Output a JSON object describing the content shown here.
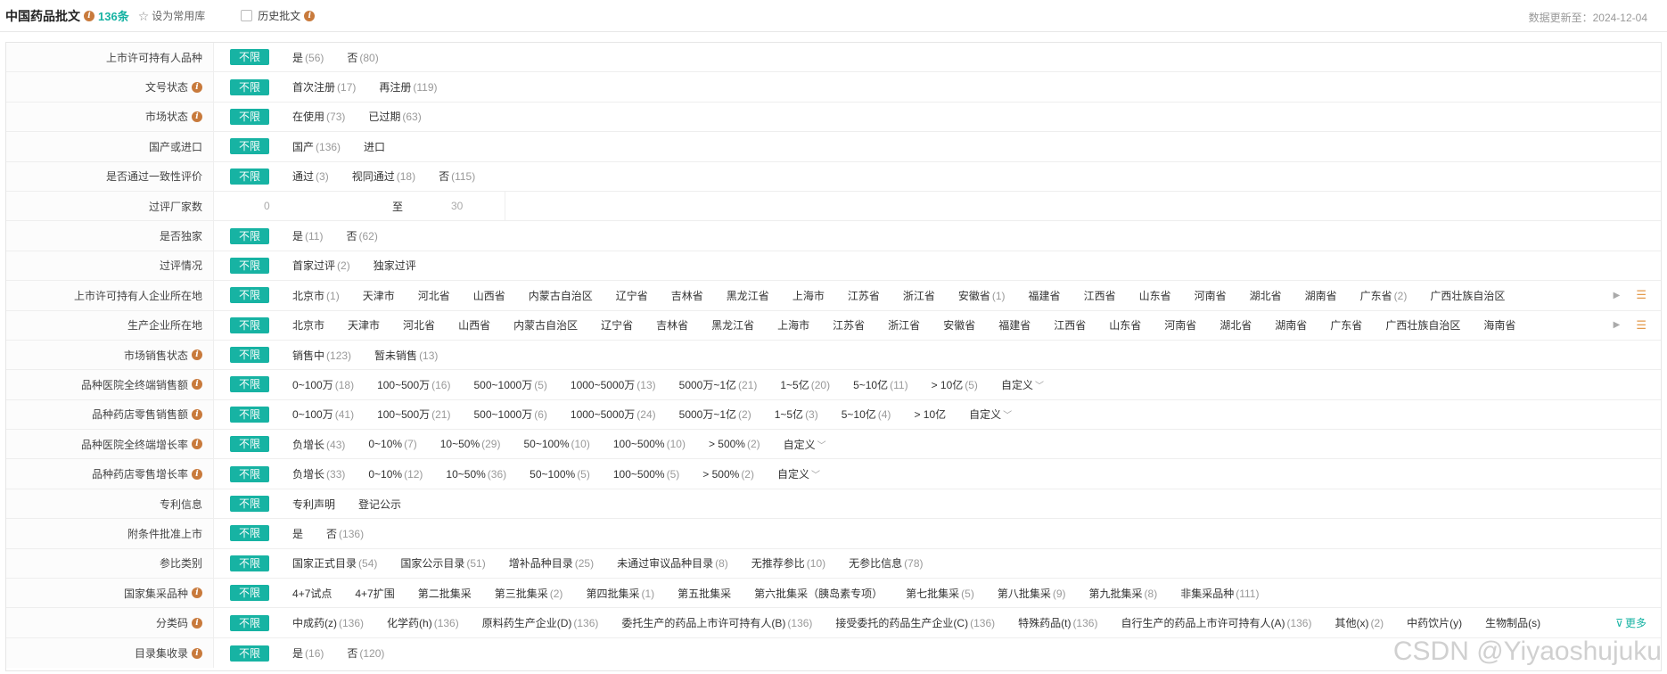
{
  "header": {
    "title": "中国药品批文",
    "count": "136条",
    "favorite_label": "设为常用库",
    "history_label": "历史批文",
    "update_label": "数据更新至：2024-12-04"
  },
  "filters": {
    "all_label": "不限",
    "custom_label": "自定义",
    "more_label": "更多",
    "range_from": "0",
    "range_sep": "至",
    "range_to": "30",
    "rows": [
      {
        "label": "上市许可持有人品种",
        "options": [
          {
            "t": "是",
            "c": "(56)"
          },
          {
            "t": "否",
            "c": "(80)"
          }
        ]
      },
      {
        "label": "文号状态",
        "options": [
          {
            "t": "首次注册",
            "c": "(17)"
          },
          {
            "t": "再注册",
            "c": "(119)"
          }
        ]
      },
      {
        "label": "市场状态",
        "options": [
          {
            "t": "在使用",
            "c": "(73)"
          },
          {
            "t": "已过期",
            "c": "(63)"
          }
        ]
      },
      {
        "label": "国产或进口",
        "options": [
          {
            "t": "国产",
            "c": "(136)"
          },
          {
            "t": "进口",
            "c": ""
          }
        ]
      },
      {
        "label": "是否通过一致性评价",
        "options": [
          {
            "t": "通过",
            "c": "(3)"
          },
          {
            "t": "视同通过",
            "c": "(18)"
          },
          {
            "t": "否",
            "c": "(115)"
          }
        ]
      },
      {
        "label": "过评厂家数"
      },
      {
        "label": "是否独家",
        "options": [
          {
            "t": "是",
            "c": "(11)"
          },
          {
            "t": "否",
            "c": "(62)"
          }
        ]
      },
      {
        "label": "过评情况",
        "options": [
          {
            "t": "首家过评",
            "c": "(2)"
          },
          {
            "t": "独家过评",
            "c": ""
          }
        ]
      },
      {
        "label": "上市许可持有人企业所在地",
        "options": [
          {
            "t": "北京市",
            "c": "(1)"
          },
          {
            "t": "天津市",
            "c": ""
          },
          {
            "t": "河北省",
            "c": ""
          },
          {
            "t": "山西省",
            "c": ""
          },
          {
            "t": "内蒙古自治区",
            "c": ""
          },
          {
            "t": "辽宁省",
            "c": ""
          },
          {
            "t": "吉林省",
            "c": ""
          },
          {
            "t": "黑龙江省",
            "c": ""
          },
          {
            "t": "上海市",
            "c": ""
          },
          {
            "t": "江苏省",
            "c": ""
          },
          {
            "t": "浙江省",
            "c": ""
          },
          {
            "t": "安徽省",
            "c": "(1)"
          },
          {
            "t": "福建省",
            "c": ""
          },
          {
            "t": "江西省",
            "c": ""
          },
          {
            "t": "山东省",
            "c": ""
          },
          {
            "t": "河南省",
            "c": ""
          },
          {
            "t": "湖北省",
            "c": ""
          },
          {
            "t": "湖南省",
            "c": ""
          },
          {
            "t": "广东省",
            "c": "(2)"
          },
          {
            "t": "广西壮族自治区",
            "c": ""
          }
        ]
      },
      {
        "label": "生产企业所在地",
        "options": [
          {
            "t": "北京市",
            "c": ""
          },
          {
            "t": "天津市",
            "c": ""
          },
          {
            "t": "河北省",
            "c": ""
          },
          {
            "t": "山西省",
            "c": ""
          },
          {
            "t": "内蒙古自治区",
            "c": ""
          },
          {
            "t": "辽宁省",
            "c": ""
          },
          {
            "t": "吉林省",
            "c": ""
          },
          {
            "t": "黑龙江省",
            "c": ""
          },
          {
            "t": "上海市",
            "c": ""
          },
          {
            "t": "江苏省",
            "c": ""
          },
          {
            "t": "浙江省",
            "c": ""
          },
          {
            "t": "安徽省",
            "c": ""
          },
          {
            "t": "福建省",
            "c": ""
          },
          {
            "t": "江西省",
            "c": ""
          },
          {
            "t": "山东省",
            "c": ""
          },
          {
            "t": "河南省",
            "c": ""
          },
          {
            "t": "湖北省",
            "c": ""
          },
          {
            "t": "湖南省",
            "c": ""
          },
          {
            "t": "广东省",
            "c": ""
          },
          {
            "t": "广西壮族自治区",
            "c": ""
          },
          {
            "t": "海南省",
            "c": ""
          }
        ]
      },
      {
        "label": "市场销售状态",
        "options": [
          {
            "t": "销售中",
            "c": "(123)"
          },
          {
            "t": "暂未销售",
            "c": "(13)"
          }
        ]
      },
      {
        "label": "品种医院全终端销售额",
        "options": [
          {
            "t": "0~100万",
            "c": "(18)"
          },
          {
            "t": "100~500万",
            "c": "(16)"
          },
          {
            "t": "500~1000万",
            "c": "(5)"
          },
          {
            "t": "1000~5000万",
            "c": "(13)"
          },
          {
            "t": "5000万~1亿",
            "c": "(21)"
          },
          {
            "t": "1~5亿",
            "c": "(20)"
          },
          {
            "t": "5~10亿",
            "c": "(11)"
          },
          {
            "t": "> 10亿",
            "c": "(5)"
          }
        ]
      },
      {
        "label": "品种药店零售销售额",
        "options": [
          {
            "t": "0~100万",
            "c": "(41)"
          },
          {
            "t": "100~500万",
            "c": "(21)"
          },
          {
            "t": "500~1000万",
            "c": "(6)"
          },
          {
            "t": "1000~5000万",
            "c": "(24)"
          },
          {
            "t": "5000万~1亿",
            "c": "(2)"
          },
          {
            "t": "1~5亿",
            "c": "(3)"
          },
          {
            "t": "5~10亿",
            "c": "(4)"
          },
          {
            "t": "> 10亿",
            "c": ""
          }
        ]
      },
      {
        "label": "品种医院全终端增长率",
        "options": [
          {
            "t": "负增长",
            "c": "(43)"
          },
          {
            "t": "0~10%",
            "c": "(7)"
          },
          {
            "t": "10~50%",
            "c": "(29)"
          },
          {
            "t": "50~100%",
            "c": "(10)"
          },
          {
            "t": "100~500%",
            "c": "(10)"
          },
          {
            "t": "> 500%",
            "c": "(2)"
          }
        ]
      },
      {
        "label": "品种药店零售增长率",
        "options": [
          {
            "t": "负增长",
            "c": "(33)"
          },
          {
            "t": "0~10%",
            "c": "(12)"
          },
          {
            "t": "10~50%",
            "c": "(36)"
          },
          {
            "t": "50~100%",
            "c": "(5)"
          },
          {
            "t": "100~500%",
            "c": "(5)"
          },
          {
            "t": "> 500%",
            "c": "(2)"
          }
        ]
      },
      {
        "label": "专利信息",
        "options": [
          {
            "t": "专利声明",
            "c": ""
          },
          {
            "t": "登记公示",
            "c": ""
          }
        ]
      },
      {
        "label": "附条件批准上市",
        "options": [
          {
            "t": "是",
            "c": ""
          },
          {
            "t": "否",
            "c": "(136)"
          }
        ]
      },
      {
        "label": "参比类别",
        "options": [
          {
            "t": "国家正式目录",
            "c": "(54)"
          },
          {
            "t": "国家公示目录",
            "c": "(51)"
          },
          {
            "t": "增补品种目录",
            "c": "(25)"
          },
          {
            "t": "未通过审议品种目录",
            "c": "(8)"
          },
          {
            "t": "无推荐参比",
            "c": "(10)"
          },
          {
            "t": "无参比信息",
            "c": "(78)"
          }
        ]
      },
      {
        "label": "国家集采品种",
        "options": [
          {
            "t": "4+7试点",
            "c": ""
          },
          {
            "t": "4+7扩围",
            "c": ""
          },
          {
            "t": "第二批集采",
            "c": ""
          },
          {
            "t": "第三批集采",
            "c": "(2)"
          },
          {
            "t": "第四批集采",
            "c": "(1)"
          },
          {
            "t": "第五批集采",
            "c": ""
          },
          {
            "t": "第六批集采（胰岛素专项）",
            "c": ""
          },
          {
            "t": "第七批集采",
            "c": "(5)"
          },
          {
            "t": "第八批集采",
            "c": "(9)"
          },
          {
            "t": "第九批集采",
            "c": "(8)"
          },
          {
            "t": "非集采品种",
            "c": "(111)"
          }
        ]
      },
      {
        "label": "分类码",
        "options": [
          {
            "t": "中成药(z)",
            "c": "(136)"
          },
          {
            "t": "化学药(h)",
            "c": "(136)"
          },
          {
            "t": "原料药生产企业(D)",
            "c": "(136)"
          },
          {
            "t": "委托生产的药品上市许可持有人(B)",
            "c": "(136)"
          },
          {
            "t": "接受委托的药品生产企业(C)",
            "c": "(136)"
          },
          {
            "t": "特殊药品(t)",
            "c": "(136)"
          },
          {
            "t": "自行生产的药品上市许可持有人(A)",
            "c": "(136)"
          },
          {
            "t": "其他(x)",
            "c": "(2)"
          },
          {
            "t": "中药饮片(y)",
            "c": ""
          },
          {
            "t": "生物制品(s)",
            "c": ""
          }
        ]
      },
      {
        "label": "目录集收录",
        "options": [
          {
            "t": "是",
            "c": "(16)"
          },
          {
            "t": "否",
            "c": "(120)"
          }
        ]
      }
    ]
  },
  "watermark": "CSDN @Yiyaoshujuku"
}
